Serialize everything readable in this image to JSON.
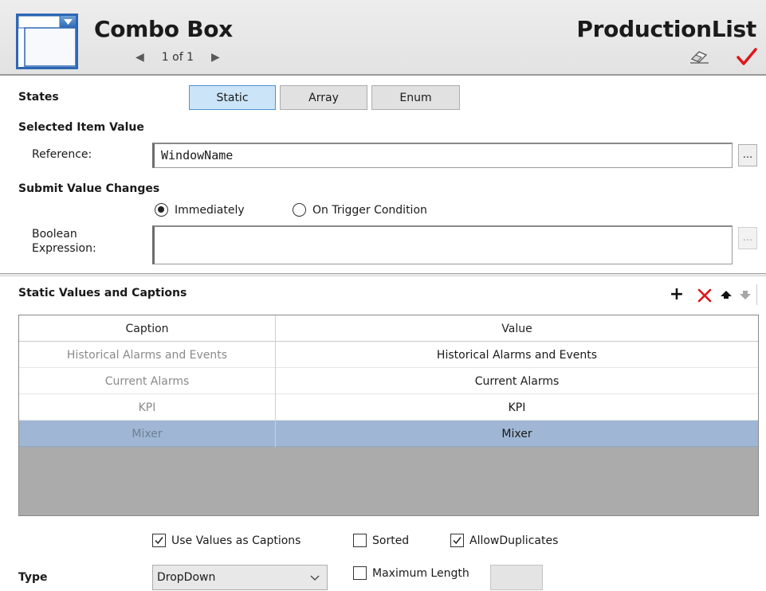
{
  "header": {
    "title": "Combo Box",
    "object_name": "ProductionList",
    "pager_text": "1 of 1",
    "icons": {
      "prev": "triangle-left",
      "next": "triangle-right",
      "eraser": "eraser",
      "apply": "checkmark"
    },
    "check_color": "#e0151b"
  },
  "states": {
    "label": "States",
    "buttons": [
      {
        "label": "Static",
        "active": true
      },
      {
        "label": "Array",
        "active": false
      },
      {
        "label": "Enum",
        "active": false
      }
    ]
  },
  "selected_item_value": {
    "heading": "Selected Item Value",
    "reference_label": "Reference:",
    "reference_value": "WindowName",
    "browse_label": "..."
  },
  "submit_value_changes": {
    "heading": "Submit Value Changes",
    "options": [
      {
        "label": "Immediately",
        "selected": true
      },
      {
        "label": "On Trigger Condition",
        "selected": false
      }
    ],
    "boolean_label_line1": "Boolean",
    "boolean_label_line2": "Expression:",
    "boolean_value": "",
    "browse_label": "..."
  },
  "static_values": {
    "heading": "Static Values and Captions",
    "toolbar": [
      "add-icon",
      "delete-icon",
      "move-up-icon",
      "move-down-icon"
    ],
    "columns": [
      "Caption",
      "Value"
    ],
    "rows": [
      {
        "caption": "Historical Alarms and Events",
        "value": "Historical Alarms and Events",
        "selected": false
      },
      {
        "caption": "Current Alarms",
        "value": "Current Alarms",
        "selected": false
      },
      {
        "caption": "KPI",
        "value": "KPI",
        "selected": false
      },
      {
        "caption": "Mixer",
        "value": "Mixer",
        "selected": true
      }
    ],
    "selection_color": "#9fb7d4"
  },
  "options": {
    "use_values_as_captions": {
      "label": "Use Values as Captions",
      "checked": true
    },
    "sorted": {
      "label": "Sorted",
      "checked": false
    },
    "allow_duplicates": {
      "label": "AllowDuplicates",
      "checked": true
    }
  },
  "type": {
    "label": "Type",
    "selected": "DropDown",
    "max_length_label": "Maximum Length",
    "max_length_checked": false,
    "max_length_value": ""
  }
}
